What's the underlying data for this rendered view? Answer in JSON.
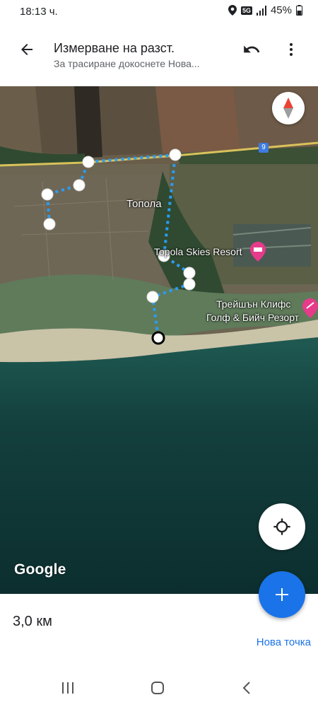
{
  "status_bar": {
    "time": "18:13 ч.",
    "battery": "45%",
    "network_badge": "5G",
    "icons": [
      "location-icon",
      "network-5g-icon",
      "signal-icon",
      "battery-icon"
    ]
  },
  "app_bar": {
    "title": "Измерване на разст.",
    "subtitle": "За трасиране докоснете Нова...",
    "icons": [
      "back-arrow-icon",
      "undo-icon",
      "more-vert-icon"
    ]
  },
  "map": {
    "place_label": "Топола",
    "poi_1": "Topola Skies Resort",
    "poi_2_line1": "Трейшън Клифс",
    "poi_2_line2": "Голф & Бийч Резорт",
    "road_badge": "9",
    "watermark": "Google",
    "colors": {
      "route": "#2b9cf2",
      "sea": "#0f3a38",
      "land": "#6b6552",
      "field": "#7a5a45",
      "poi_pin": "#e63b8a"
    }
  },
  "bottom": {
    "distance": "3,0 км",
    "add_point_label": "Нова точка",
    "fab_icon": "plus-icon",
    "locate_icon": "my-location-icon",
    "compass_icon": "compass-icon"
  },
  "nav_bar": {
    "icons": [
      "recent-apps-icon",
      "home-icon",
      "back-icon"
    ]
  }
}
